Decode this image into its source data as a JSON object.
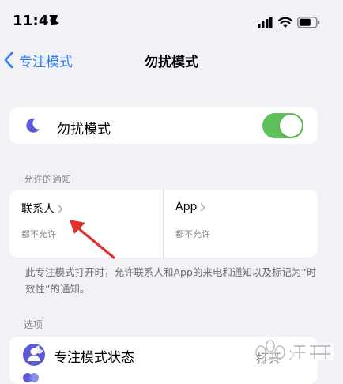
{
  "status_bar": {
    "time": "11:47"
  },
  "nav": {
    "back_label": "专注模式",
    "title": "勿扰模式"
  },
  "dnd_row": {
    "label": "勿扰模式",
    "toggle_on": true
  },
  "allowed_section": {
    "header": "允许的通知",
    "people": {
      "title": "联系人",
      "subtitle": "都不允许"
    },
    "apps": {
      "title": "App",
      "subtitle": "都不允许"
    },
    "footnote": "此专注模式打开时，允许联系人和App的来电和通知以及标记为“时效性”的通知。"
  },
  "options_section": {
    "header": "选项",
    "focus_status": {
      "label": "专注模式状态",
      "value": "打开"
    }
  },
  "colors": {
    "accent": "#2f7cf6",
    "toggle_on": "#5fc15a",
    "moon": "#5b5bd6",
    "arrow": "#e0302b"
  }
}
